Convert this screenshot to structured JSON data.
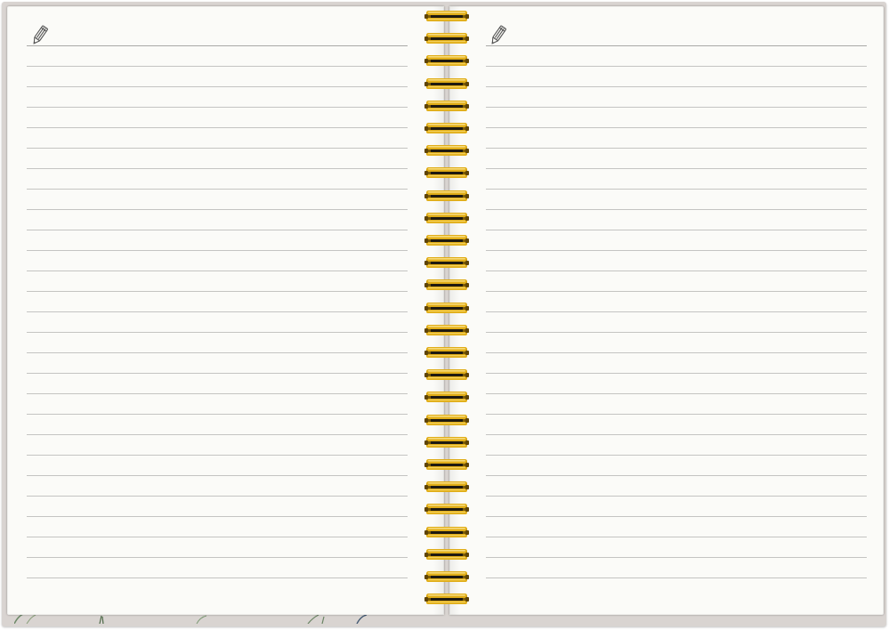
{
  "notebook": {
    "left_page": {
      "icon": "pencil-icon",
      "ruled_lines": 27
    },
    "right_page": {
      "icon": "pencil-icon",
      "ruled_lines": 27
    },
    "spiral": {
      "coils": 27,
      "color": "#e0ad18"
    },
    "colors": {
      "page": "#fbfbf8",
      "cover": "#d9d4d1",
      "rule": "#c4c4c2"
    }
  }
}
